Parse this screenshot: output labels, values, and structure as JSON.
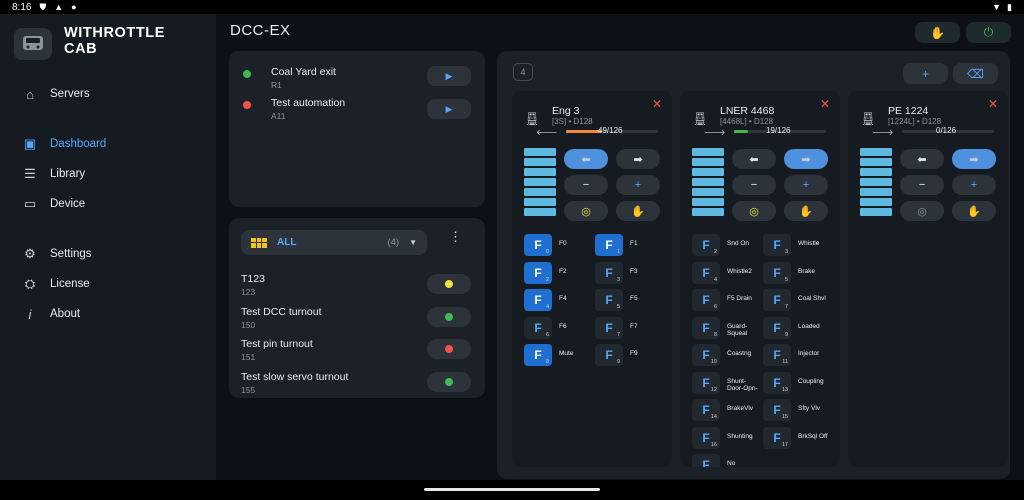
{
  "status": {
    "time": "8:16"
  },
  "sidebar": {
    "brand": "WITHROTTLE CAB",
    "items": [
      {
        "label": "Servers",
        "icon": "home-icon"
      },
      {
        "label": "Dashboard",
        "icon": "dashboard-icon",
        "active": true
      },
      {
        "label": "Library",
        "icon": "list-icon"
      },
      {
        "label": "Device",
        "icon": "device-icon"
      },
      {
        "label": "Settings",
        "icon": "settings-icon"
      },
      {
        "label": "License",
        "icon": "license-icon"
      },
      {
        "label": "About",
        "icon": "info-icon"
      }
    ]
  },
  "header": {
    "title": "DCC-EX"
  },
  "automations": [
    {
      "name": "Coal Yard exit",
      "id": "R1",
      "status_color": "#3fb950"
    },
    {
      "name": "Test automation",
      "id": "A11",
      "status_color": "#f85149"
    }
  ],
  "turnouts": {
    "filter_label": "ALL",
    "filter_count": "(4)",
    "items": [
      {
        "name": "T123",
        "id": "123",
        "state_color": "#f0e040"
      },
      {
        "name": "Test DCC turnout",
        "id": "150",
        "state_color": "#3fb950"
      },
      {
        "name": "Test pin turnout",
        "id": "151",
        "state_color": "#f85149"
      },
      {
        "name": "Test slow servo turnout",
        "id": "155",
        "state_color": "#3fb950"
      }
    ]
  },
  "throttle_count": "4",
  "throttles": [
    {
      "name": "Eng 3",
      "sub": "[3S] • D128",
      "speed": "49/126",
      "speed_fraction": 0.39,
      "fill_color": "#f0883e",
      "functions": [
        {
          "label": "F0",
          "num": "0",
          "on": true
        },
        {
          "label": "F1",
          "num": "1",
          "on": true
        },
        {
          "label": "F2",
          "num": "2",
          "on": true
        },
        {
          "label": "F3",
          "num": "3",
          "on": false
        },
        {
          "label": "F4",
          "num": "4",
          "on": true
        },
        {
          "label": "F5",
          "num": "5",
          "on": false
        },
        {
          "label": "F6",
          "num": "6",
          "on": false
        },
        {
          "label": "F7",
          "num": "7",
          "on": false
        },
        {
          "label": "Mute",
          "num": "8",
          "on": true
        },
        {
          "label": "F9",
          "num": "9",
          "on": false
        }
      ]
    },
    {
      "name": "LNER 4468",
      "sub": "[4468L] • D128",
      "speed": "19/126",
      "speed_fraction": 0.15,
      "fill_color": "#3fb950",
      "functions": [
        {
          "label": "Snd On",
          "num": "2"
        },
        {
          "label": "Whistle",
          "num": "3"
        },
        {
          "label": "Whistle2",
          "num": "4"
        },
        {
          "label": "Brake",
          "num": "5"
        },
        {
          "label": "F5 Drain",
          "num": "6"
        },
        {
          "label": "Coal Shvl",
          "num": "7"
        },
        {
          "label": "Guard-Squeal",
          "num": "8"
        },
        {
          "label": "Loaded",
          "num": "9"
        },
        {
          "label": "Coastng",
          "num": "10"
        },
        {
          "label": "Injector",
          "num": "11"
        },
        {
          "label": "Shunt-Door-Opn-",
          "num": "12"
        },
        {
          "label": "Coupling",
          "num": "13"
        },
        {
          "label": "BrakeVlv",
          "num": "14"
        },
        {
          "label": "Sfty Vlv",
          "num": "15"
        },
        {
          "label": "Shunting",
          "num": "16"
        },
        {
          "label": "BrkSql Off",
          "num": "17"
        },
        {
          "label": "No",
          "num": "18"
        }
      ]
    },
    {
      "name": "PE 1224",
      "sub": "[1224L] • D128",
      "speed": "0/126",
      "speed_fraction": 0.0,
      "fill_color": "#3fb950",
      "functions": []
    }
  ]
}
